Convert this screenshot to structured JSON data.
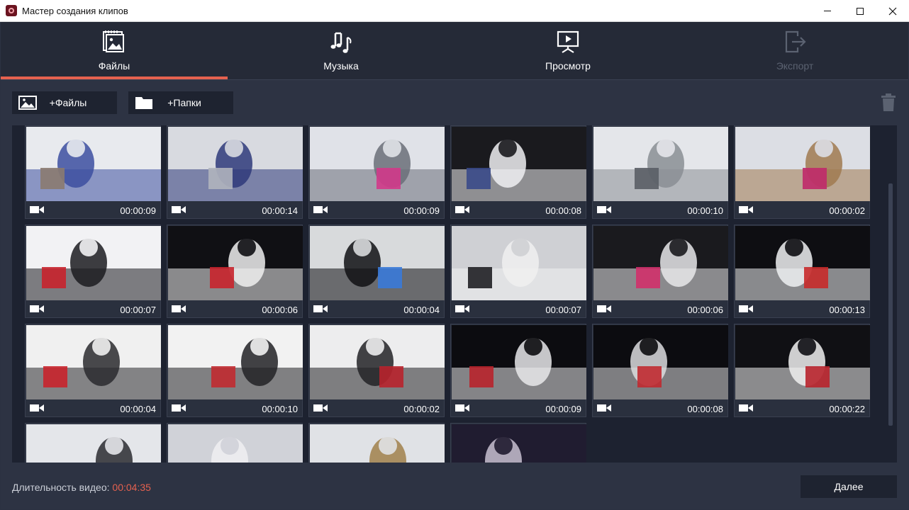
{
  "window": {
    "title": "Мастер создания клипов"
  },
  "tabs": [
    {
      "label": "Файлы",
      "icon": "images-icon",
      "active": true
    },
    {
      "label": "Музыка",
      "icon": "music-icon"
    },
    {
      "label": "Просмотр",
      "icon": "preview-icon"
    },
    {
      "label": "Экспорт",
      "icon": "export-icon",
      "disabled": true
    }
  ],
  "toolbar": {
    "add_files_label": "+Файлы",
    "add_folders_label": "+Папки"
  },
  "clips": [
    {
      "duration": "00:00:09",
      "scene": "showroom"
    },
    {
      "duration": "00:00:14",
      "scene": "robot-girl"
    },
    {
      "duration": "00:00:09",
      "scene": "robot-hug"
    },
    {
      "duration": "00:00:08",
      "scene": "eve-robot"
    },
    {
      "duration": "00:00:10",
      "scene": "store-robot"
    },
    {
      "duration": "00:00:02",
      "scene": "store-kids"
    },
    {
      "duration": "00:00:07",
      "scene": "white-robot"
    },
    {
      "duration": "00:00:06",
      "scene": "white-robot-close"
    },
    {
      "duration": "00:00:04",
      "scene": "black-robot"
    },
    {
      "duration": "00:00:07",
      "scene": "poster"
    },
    {
      "duration": "00:00:06",
      "scene": "hockey-girl"
    },
    {
      "duration": "00:00:13",
      "scene": "air-hockey"
    },
    {
      "duration": "00:00:04",
      "scene": "lego-cube"
    },
    {
      "duration": "00:00:10",
      "scene": "lego-arm"
    },
    {
      "duration": "00:00:02",
      "scene": "lego-machine"
    },
    {
      "duration": "00:00:09",
      "scene": "lego-bot"
    },
    {
      "duration": "00:00:08",
      "scene": "lego-bot-2"
    },
    {
      "duration": "00:00:22",
      "scene": "person-robot"
    },
    {
      "duration": "",
      "scene": "expo-hall"
    },
    {
      "duration": "",
      "scene": "vr-headset"
    },
    {
      "duration": "",
      "scene": "expo-vr"
    },
    {
      "duration": "",
      "scene": "dark-room"
    }
  ],
  "footer": {
    "duration_label": "Длительность видео:",
    "duration_value": "00:04:35",
    "next_label": "Далее"
  },
  "colors": {
    "accent": "#e5614f",
    "panel": "#2d3343",
    "tabbar": "#252a37",
    "gallery": "#1d2230"
  }
}
